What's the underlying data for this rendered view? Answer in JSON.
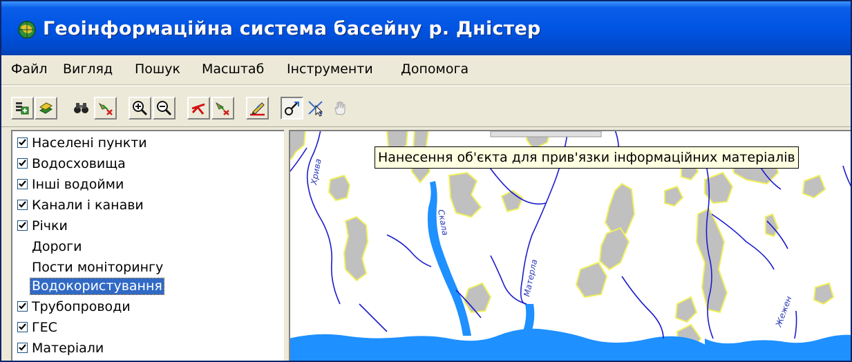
{
  "window": {
    "title": "Геоінформаційна система басейну р. Дністер",
    "app_icon": "globe-icon"
  },
  "menu": [
    {
      "label": "Файл"
    },
    {
      "label": "Вигляд"
    },
    {
      "label": "Пошук"
    },
    {
      "label": "Масштаб"
    },
    {
      "label": "Інструменти"
    },
    {
      "label": "Допомога"
    }
  ],
  "toolbar": [
    {
      "icon": "add-layer-icon"
    },
    {
      "icon": "layers-icon"
    },
    {
      "icon": "binoculars-search-icon"
    },
    {
      "icon": "clear-selection-icon"
    },
    {
      "icon": "zoom-in-icon"
    },
    {
      "icon": "zoom-out-icon"
    },
    {
      "icon": "pan-arrows-icon"
    },
    {
      "icon": "clear-markers-icon"
    },
    {
      "icon": "edit-pen-icon"
    },
    {
      "icon": "place-object-icon",
      "pressed": true
    },
    {
      "icon": "select-pointer-icon"
    },
    {
      "icon": "hand-pan-icon",
      "disabled": true
    }
  ],
  "layers": [
    {
      "label": "Населені пункти",
      "checked": true
    },
    {
      "label": "Водосховища",
      "checked": true
    },
    {
      "label": "Інші водойми",
      "checked": true
    },
    {
      "label": "Канали і канави",
      "checked": true
    },
    {
      "label": "Річки",
      "checked": true
    },
    {
      "label": "Дороги",
      "checked": false
    },
    {
      "label": "Пости моніторингу",
      "checked": false
    },
    {
      "label": "Водокористування",
      "checked": false,
      "selected": true
    },
    {
      "label": "Трубопроводи",
      "checked": true
    },
    {
      "label": "ГЕС",
      "checked": true
    },
    {
      "label": "Матеріали",
      "checked": true
    }
  ],
  "tooltip": {
    "text": "Нанесення об'єкта для прив'язки інформаційних матеріалів"
  },
  "map": {
    "colors": {
      "settlement_fill": "#c0c0c0",
      "settlement_border": "#f0f05a",
      "river": "#1a1acd",
      "reservoir": "#1e90ff",
      "background": "#ffffff"
    },
    "labels": [
      {
        "text": "Хрива"
      },
      {
        "text": "Скала"
      },
      {
        "text": "Матерла"
      },
      {
        "text": "Жежен"
      }
    ]
  },
  "colors": {
    "titlebar": "#0054e3",
    "selection": "#316ac5",
    "tooltip_bg": "#ffffe1",
    "chrome": "#ece9d8"
  }
}
